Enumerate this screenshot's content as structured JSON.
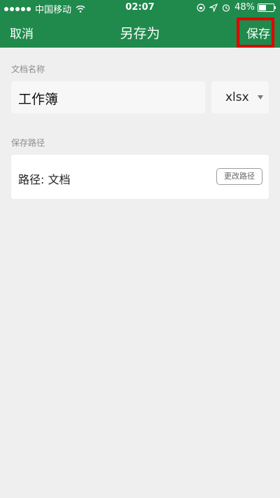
{
  "status_bar": {
    "carrier": "中国移动",
    "time": "02:07",
    "battery_percent": "48%",
    "battery_level": 0.48,
    "icons": [
      "signal-dots-icon",
      "wifi-icon",
      "orientation-lock-icon",
      "location-arrow-icon",
      "alarm-icon",
      "battery-icon"
    ]
  },
  "nav": {
    "cancel": "取消",
    "title": "另存为",
    "save": "保存"
  },
  "form": {
    "name_label": "文档名称",
    "name_value": "工作簿",
    "extension": "xlsx",
    "path_label": "保存路径",
    "path_value": "路径: 文档",
    "change_path_button": "更改路径"
  },
  "colors": {
    "header_green": "#1f8a4c",
    "background": "#efefef",
    "highlight_red": "#e00000"
  }
}
